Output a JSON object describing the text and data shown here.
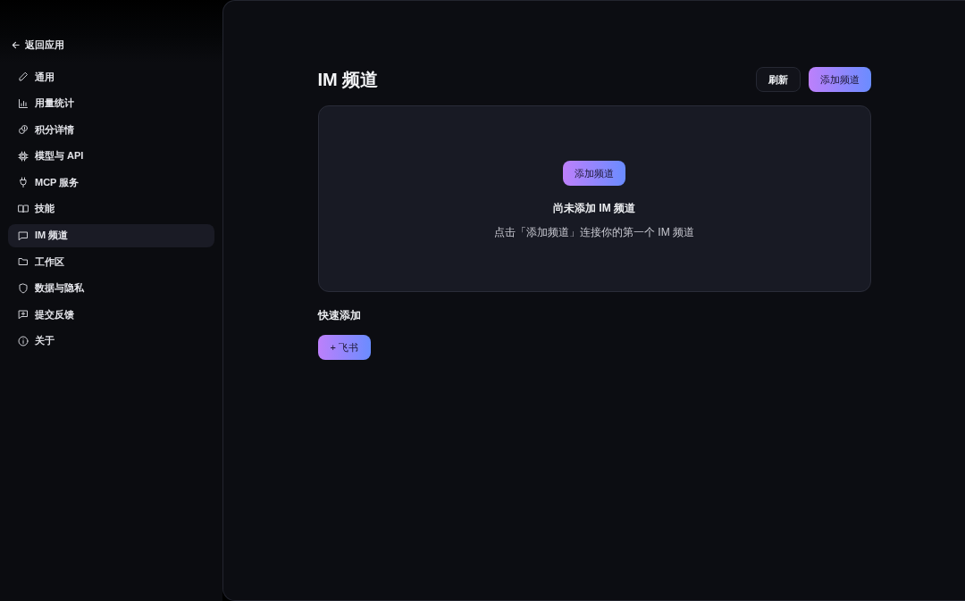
{
  "sidebar": {
    "back_link": {
      "label": "返回应用"
    },
    "items": [
      {
        "label": "通用",
        "selected": false
      },
      {
        "label": "用量统计",
        "selected": false
      },
      {
        "label": "积分详情",
        "selected": false
      },
      {
        "label": "模型与 API",
        "selected": false
      },
      {
        "label": "MCP 服务",
        "selected": false
      },
      {
        "label": "技能",
        "selected": false
      },
      {
        "label": "IM 频道",
        "selected": true
      },
      {
        "label": "工作区",
        "selected": false
      },
      {
        "label": "数据与隐私",
        "selected": false
      },
      {
        "label": "提交反馈",
        "selected": false
      },
      {
        "label": "关于",
        "selected": false
      }
    ]
  },
  "page": {
    "title": "IM 频道",
    "actions": [
      {
        "label": "刷新",
        "kind": "secondary"
      },
      {
        "label": "添加频道",
        "kind": "primary"
      }
    ]
  },
  "empty_state": {
    "button": "添加频道",
    "title": "尚未添加 IM 频道",
    "description": "点击「添加频道」连接你的第一个 IM 频道"
  },
  "quick_add": {
    "heading": "快速添加",
    "items": [
      {
        "label": "+ 飞书"
      }
    ]
  }
}
